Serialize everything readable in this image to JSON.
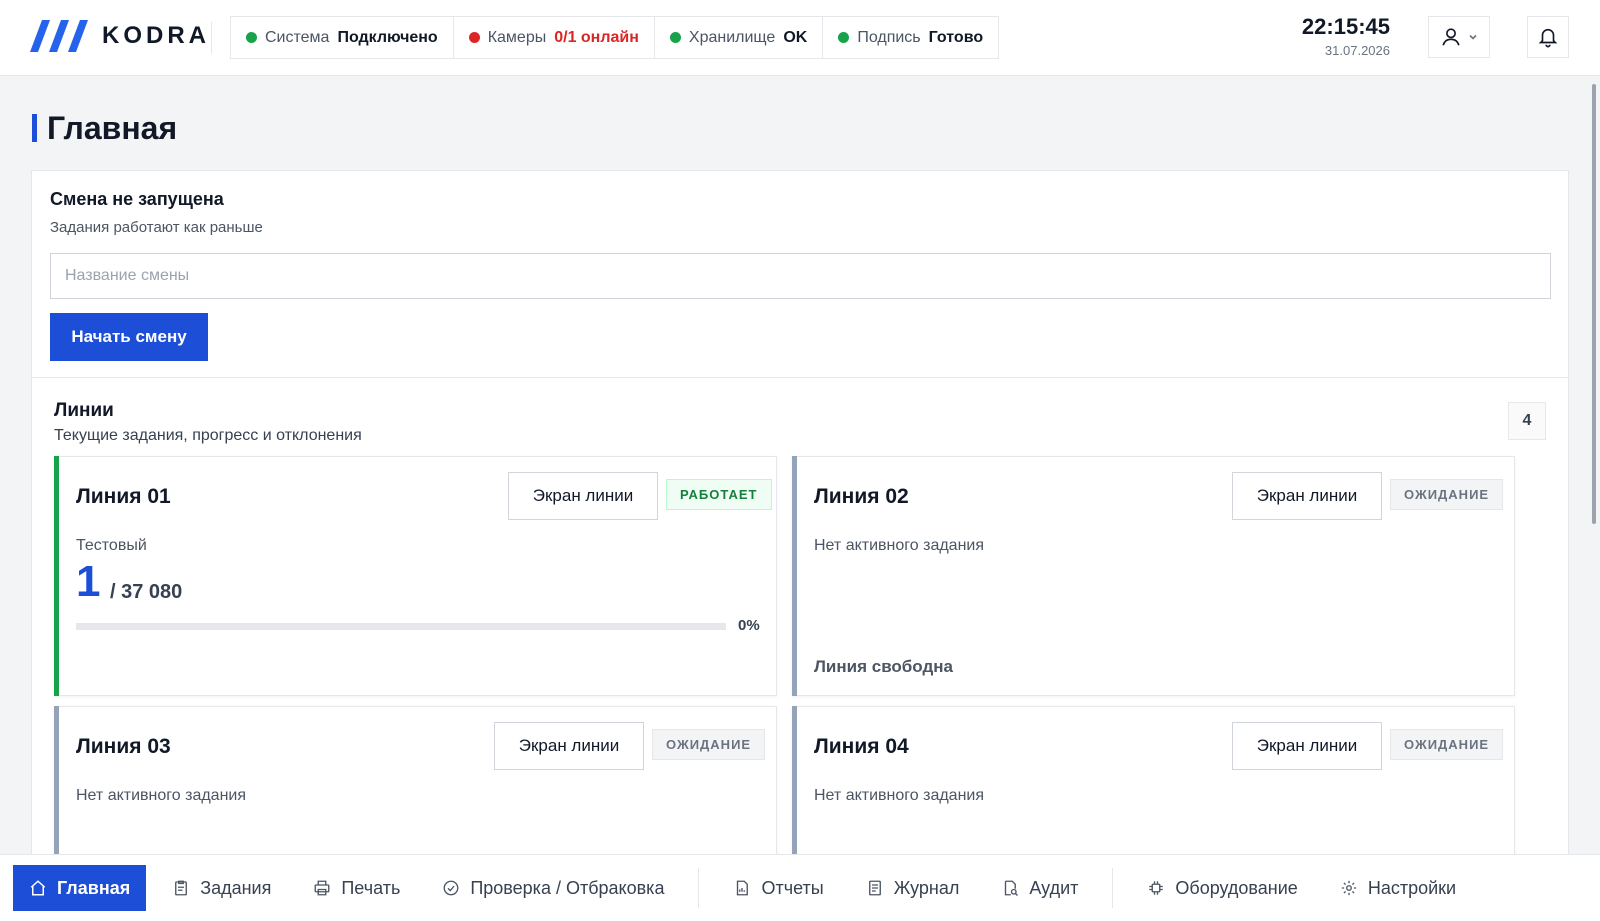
{
  "app": {
    "brand": "KODRA"
  },
  "status": [
    {
      "label": "Система",
      "value": "Подключено",
      "dot_color": "#16a34a",
      "value_color": "#111827"
    },
    {
      "label": "Камеры",
      "value": "0/1 онлайн",
      "dot_color": "#dc2626",
      "value_color": "#dc2626"
    },
    {
      "label": "Хранилище",
      "value": "OK",
      "dot_color": "#16a34a",
      "value_color": "#111827"
    },
    {
      "label": "Подпись",
      "value": "Готово",
      "dot_color": "#16a34a",
      "value_color": "#111827"
    }
  ],
  "clock": {
    "time": "22:15:45",
    "date": "31.07.2026"
  },
  "page": {
    "title": "Главная"
  },
  "shift": {
    "title": "Смена не запущена",
    "subtitle": "Задания работают как раньше",
    "input_placeholder": "Название смены",
    "input_value": "",
    "start_label": "Начать смену"
  },
  "lines": {
    "title": "Линии",
    "subtitle": "Текущие задания, прогресс и отклонения",
    "count": "4",
    "items": [
      {
        "name": "Линия 01",
        "button": "Экран линии",
        "badge": "РАБОТАЕТ",
        "status": "running",
        "task": "Тестовый",
        "done": "1",
        "total": "/ 37 080",
        "percent_label": "0%",
        "progress": 0,
        "free_label": ""
      },
      {
        "name": "Линия 02",
        "button": "Экран линии",
        "badge": "ОЖИДАНИЕ",
        "status": "waiting",
        "task": "Нет активного задания",
        "free_label": "Линия свободна"
      },
      {
        "name": "Линия 03",
        "button": "Экран линии",
        "badge": "ОЖИДАНИЕ",
        "status": "waiting",
        "task": "Нет активного задания",
        "free_label": ""
      },
      {
        "name": "Линия 04",
        "button": "Экран линии",
        "badge": "ОЖИДАНИЕ",
        "status": "waiting",
        "task": "Нет активного задания",
        "free_label": ""
      }
    ]
  },
  "nav": {
    "items": [
      {
        "label": "Главная",
        "icon": "home-icon",
        "active": true
      },
      {
        "label": "Задания",
        "icon": "clipboard-icon"
      },
      {
        "label": "Печать",
        "icon": "printer-icon"
      },
      {
        "label": "Проверка / Отбраковка",
        "icon": "check-circle-icon"
      },
      {
        "label": "Отчеты",
        "icon": "report-icon"
      },
      {
        "label": "Журнал",
        "icon": "journal-icon"
      },
      {
        "label": "Аудит",
        "icon": "audit-icon"
      },
      {
        "label": "Оборудование",
        "icon": "chip-icon"
      },
      {
        "label": "Настройки",
        "icon": "gear-icon"
      }
    ]
  },
  "colors": {
    "accent": "#1d4ed8",
    "running": "#16a34a",
    "waiting": "#94a3b8"
  }
}
